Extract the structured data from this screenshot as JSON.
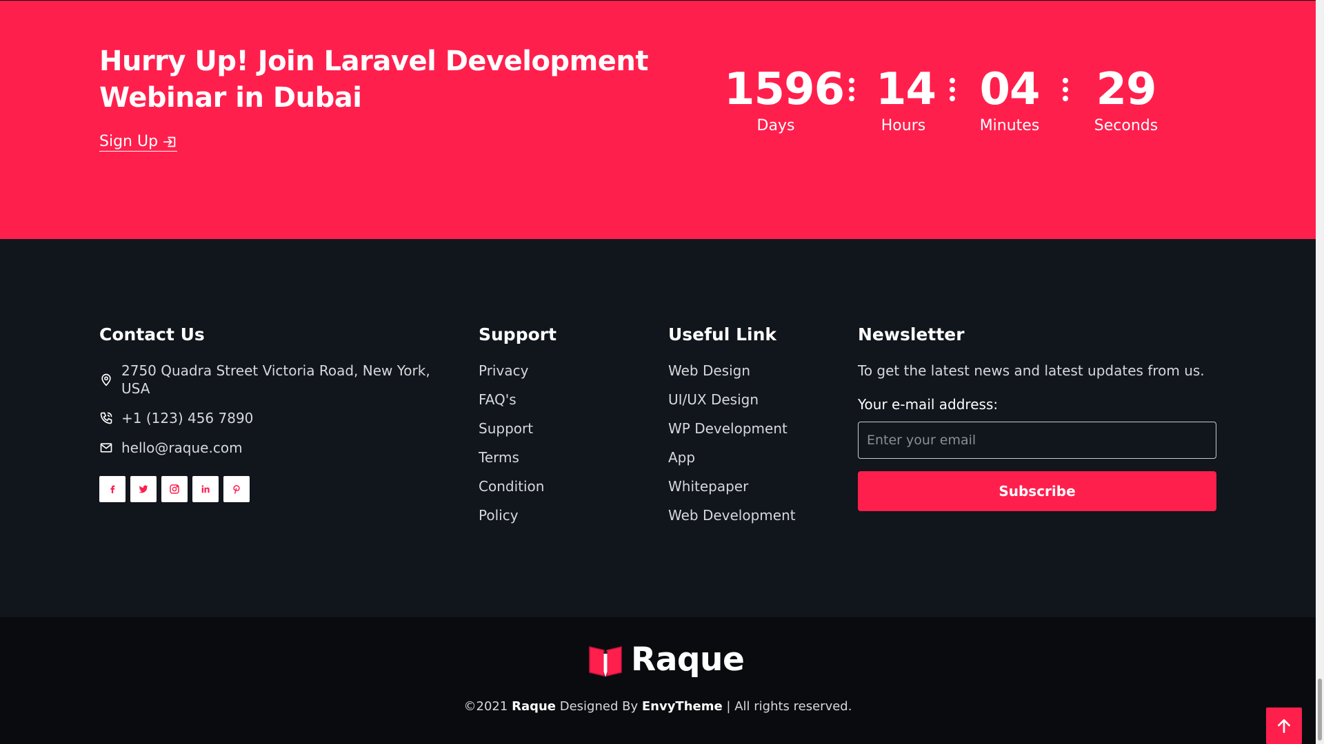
{
  "promo": {
    "title": "Hurry Up! Join Laravel Development Webinar in Dubai",
    "signup_label": "Sign Up",
    "countdown": [
      {
        "value": "1596",
        "label": "Days"
      },
      {
        "value": "14",
        "label": "Hours"
      },
      {
        "value": "04",
        "label": "Minutes"
      },
      {
        "value": "29",
        "label": "Seconds"
      }
    ]
  },
  "contact": {
    "heading": "Contact Us",
    "address": "2750 Quadra Street Victoria Road, New York, USA",
    "phone": "+1 (123) 456 7890",
    "email": "hello@raque.com",
    "socials": [
      "facebook-icon",
      "twitter-icon",
      "instagram-icon",
      "linkedin-icon",
      "pinterest-icon"
    ]
  },
  "support": {
    "heading": "Support",
    "links": [
      "Privacy",
      "FAQ's",
      "Support",
      "Terms",
      "Condition",
      "Policy"
    ]
  },
  "useful": {
    "heading": "Useful Link",
    "links": [
      "Web Design",
      "UI/UX Design",
      "WP Development",
      "App",
      "Whitepaper",
      "Web Development"
    ]
  },
  "newsletter": {
    "heading": "Newsletter",
    "text": "To get the latest news and latest updates from us.",
    "label": "Your e-mail address:",
    "placeholder": "Enter your email",
    "button": "Subscribe"
  },
  "bottom": {
    "logo_text": "Raque",
    "copy_prefix": "©2021",
    "brand": "Raque",
    "designed_by": "Designed By",
    "designer": "EnvyTheme",
    "rights": "| All rights reserved."
  },
  "colors": {
    "accent": "#ff1f4d",
    "footer_bg": "#11151c",
    "bottom_bg": "#090b0f"
  }
}
